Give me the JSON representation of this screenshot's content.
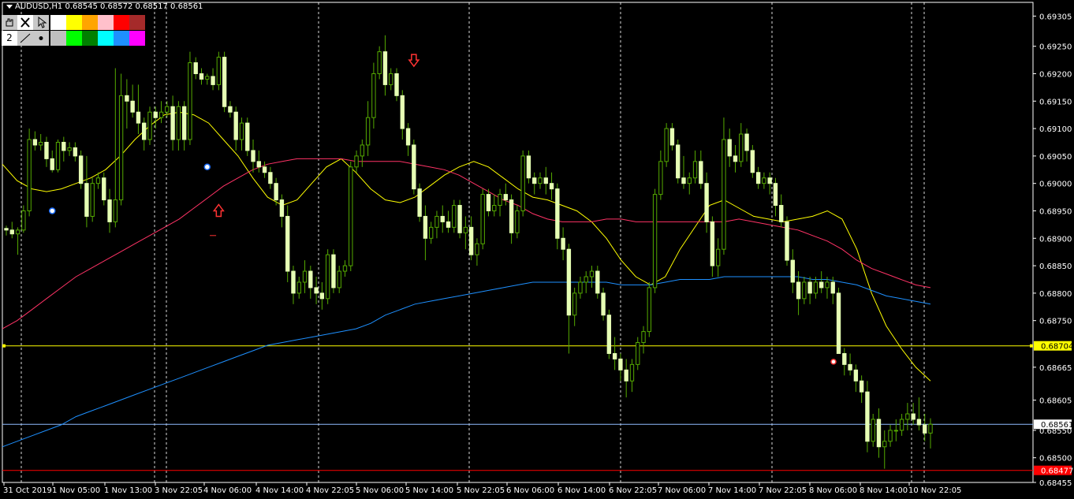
{
  "header": {
    "title": "AUDUSD,H1  0.68545 0.68572 0.68517 0.68561"
  },
  "toolbar": {
    "row1_icons": [
      "hand-icon",
      "close-icon",
      "pointer-icon"
    ],
    "row2": {
      "thickness_value": "2",
      "line_icon": "line-style-icon",
      "dot_icon": "dot-style-icon"
    },
    "colors_row1": [
      "#ffffff",
      "#ffff00",
      "#ffa500",
      "#ffc0cb",
      "#ff0000",
      "#a52a2a"
    ],
    "colors_row2": [
      "#c0c0c0",
      "#00ff00",
      "#008000",
      "#00ffff",
      "#1e90ff",
      "#ff00ff"
    ]
  },
  "colors": {
    "background": "#000000",
    "candle": "#e6ffb4",
    "wick": "#55aa00",
    "grid": "#ffffff",
    "ma_fast": "#ffff00",
    "ma_mid": "#ff3366",
    "ma_slow": "#1e90ff",
    "level_yellow": "#ffff00",
    "level_blue": "#8fbcff",
    "level_red": "#ff0000"
  },
  "chart_data": {
    "type": "candlestick",
    "symbol": "AUDUSD",
    "timeframe": "H1",
    "ylim": [
      0.68455,
      0.6933
    ],
    "y_ticks": [
      "0.69305",
      "0.69250",
      "0.69200",
      "0.69150",
      "0.69100",
      "0.69050",
      "0.69000",
      "0.68950",
      "0.68900",
      "0.68850",
      "0.68800",
      "0.68750",
      "0.68665",
      "0.68605",
      "0.68550",
      "0.68500",
      "0.68455"
    ],
    "x_ticks": [
      "31 Oct 2019",
      "1 Nov 05:00",
      "1 Nov 13:00",
      "3 Nov 22:05",
      "4 Nov 06:00",
      "4 Nov 14:00",
      "4 Nov 22:05",
      "5 Nov 06:00",
      "5 Nov 14:00",
      "5 Nov 22:05",
      "6 Nov 06:00",
      "6 Nov 14:00",
      "6 Nov 22:05",
      "7 Nov 06:00",
      "7 Nov 14:00",
      "7 Nov 22:05",
      "8 Nov 06:00",
      "8 Nov 14:00",
      "10 Nov 22:05"
    ],
    "levels": [
      {
        "name": "yellow-level",
        "value": 0.68704,
        "label": "0.68704",
        "color": "#ffff00"
      },
      {
        "name": "current-price",
        "value": 0.68561,
        "label": "0.68561",
        "color": "#8fbcff"
      },
      {
        "name": "red-level",
        "value": 0.68477,
        "label": "0.68477",
        "color": "#ff0000"
      }
    ],
    "candles": [
      [
        0.68918,
        0.68923,
        0.68905,
        0.68915
      ],
      [
        0.68915,
        0.6893,
        0.689,
        0.68908
      ],
      [
        0.68908,
        0.6892,
        0.6887,
        0.68915
      ],
      [
        0.68915,
        0.6896,
        0.6891,
        0.6895
      ],
      [
        0.6895,
        0.691,
        0.6894,
        0.6908
      ],
      [
        0.6908,
        0.69095,
        0.6906,
        0.6907
      ],
      [
        0.6907,
        0.6909,
        0.6906,
        0.69075
      ],
      [
        0.69075,
        0.69085,
        0.6903,
        0.69045
      ],
      [
        0.69045,
        0.6906,
        0.6902,
        0.69025
      ],
      [
        0.69025,
        0.6908,
        0.6902,
        0.69075
      ],
      [
        0.69075,
        0.69085,
        0.6904,
        0.6906
      ],
      [
        0.6906,
        0.69075,
        0.6905,
        0.69065
      ],
      [
        0.69065,
        0.69075,
        0.6904,
        0.6905
      ],
      [
        0.6905,
        0.6906,
        0.6899,
        0.69
      ],
      [
        0.69,
        0.6905,
        0.6892,
        0.6894
      ],
      [
        0.6894,
        0.6901,
        0.6893,
        0.69
      ],
      [
        0.69,
        0.6902,
        0.6899,
        0.6901
      ],
      [
        0.6901,
        0.6902,
        0.6896,
        0.6897
      ],
      [
        0.6897,
        0.6899,
        0.6891,
        0.6893
      ],
      [
        0.6893,
        0.6921,
        0.6892,
        0.6897
      ],
      [
        0.6897,
        0.692,
        0.6896,
        0.6916
      ],
      [
        0.6916,
        0.6919,
        0.691,
        0.6915
      ],
      [
        0.6915,
        0.6918,
        0.6912,
        0.6913
      ],
      [
        0.6913,
        0.6918,
        0.6909,
        0.6911
      ],
      [
        0.6911,
        0.6912,
        0.6906,
        0.6908
      ],
      [
        0.6908,
        0.6914,
        0.6907,
        0.6913
      ],
      [
        0.6913,
        0.6914,
        0.691,
        0.6912
      ],
      [
        0.6912,
        0.6915,
        0.6911,
        0.6913
      ],
      [
        0.6913,
        0.6915,
        0.6912,
        0.6914
      ],
      [
        0.6914,
        0.6916,
        0.6906,
        0.6908
      ],
      [
        0.6908,
        0.6915,
        0.6906,
        0.6914
      ],
      [
        0.6914,
        0.6915,
        0.6906,
        0.6908
      ],
      [
        0.6908,
        0.6924,
        0.6907,
        0.6922
      ],
      [
        0.6922,
        0.6923,
        0.6919,
        0.692
      ],
      [
        0.692,
        0.6921,
        0.6918,
        0.6919
      ],
      [
        0.6919,
        0.692,
        0.6918,
        0.69195
      ],
      [
        0.69195,
        0.6921,
        0.6917,
        0.6918
      ],
      [
        0.6918,
        0.6924,
        0.6917,
        0.6923
      ],
      [
        0.6923,
        0.6924,
        0.6913,
        0.6914
      ],
      [
        0.6914,
        0.6915,
        0.6912,
        0.6913
      ],
      [
        0.6913,
        0.6914,
        0.6906,
        0.6908
      ],
      [
        0.6908,
        0.6912,
        0.6906,
        0.6911
      ],
      [
        0.6911,
        0.6912,
        0.6905,
        0.6906
      ],
      [
        0.6906,
        0.6908,
        0.6902,
        0.6904
      ],
      [
        0.6904,
        0.6906,
        0.6902,
        0.6903
      ],
      [
        0.6903,
        0.6904,
        0.6901,
        0.6902
      ],
      [
        0.6902,
        0.6903,
        0.6899,
        0.69
      ],
      [
        0.69,
        0.6901,
        0.6896,
        0.6897
      ],
      [
        0.6897,
        0.6898,
        0.6892,
        0.6894
      ],
      [
        0.6894,
        0.6896,
        0.6882,
        0.6884
      ],
      [
        0.6884,
        0.6885,
        0.6878,
        0.688
      ],
      [
        0.688,
        0.6883,
        0.6879,
        0.6882
      ],
      [
        0.6882,
        0.6886,
        0.688,
        0.6884
      ],
      [
        0.6884,
        0.6885,
        0.6879,
        0.6881
      ],
      [
        0.6881,
        0.6883,
        0.6878,
        0.688
      ],
      [
        0.688,
        0.6882,
        0.6877,
        0.6879
      ],
      [
        0.6879,
        0.6888,
        0.6878,
        0.6887
      ],
      [
        0.6887,
        0.6888,
        0.688,
        0.6881
      ],
      [
        0.6881,
        0.6885,
        0.688,
        0.6884
      ],
      [
        0.6884,
        0.6886,
        0.6883,
        0.6885
      ],
      [
        0.6885,
        0.6904,
        0.6884,
        0.6903
      ],
      [
        0.6903,
        0.6906,
        0.6902,
        0.6905
      ],
      [
        0.6905,
        0.6908,
        0.6903,
        0.6907
      ],
      [
        0.6907,
        0.6915,
        0.6905,
        0.6912
      ],
      [
        0.6912,
        0.6922,
        0.691,
        0.692
      ],
      [
        0.692,
        0.6925,
        0.6919,
        0.6924
      ],
      [
        0.6924,
        0.6927,
        0.6916,
        0.6918
      ],
      [
        0.6918,
        0.6921,
        0.6917,
        0.692
      ],
      [
        0.692,
        0.6921,
        0.6915,
        0.6916
      ],
      [
        0.6916,
        0.6917,
        0.6908,
        0.691
      ],
      [
        0.691,
        0.6911,
        0.6905,
        0.6907
      ],
      [
        0.6907,
        0.6908,
        0.6898,
        0.6899
      ],
      [
        0.6899,
        0.69,
        0.6893,
        0.6894
      ],
      [
        0.6894,
        0.6896,
        0.6886,
        0.689
      ],
      [
        0.689,
        0.6893,
        0.6889,
        0.6892
      ],
      [
        0.6892,
        0.6895,
        0.689,
        0.6894
      ],
      [
        0.6894,
        0.6896,
        0.6891,
        0.6893
      ],
      [
        0.6893,
        0.6895,
        0.6891,
        0.6892
      ],
      [
        0.6892,
        0.6897,
        0.6891,
        0.6896
      ],
      [
        0.6896,
        0.6897,
        0.689,
        0.6891
      ],
      [
        0.6891,
        0.6894,
        0.6888,
        0.6892
      ],
      [
        0.6892,
        0.6894,
        0.6886,
        0.6887
      ],
      [
        0.6887,
        0.689,
        0.6885,
        0.6889
      ],
      [
        0.6889,
        0.6899,
        0.6888,
        0.6898
      ],
      [
        0.6898,
        0.6899,
        0.6894,
        0.6895
      ],
      [
        0.6895,
        0.6898,
        0.6894,
        0.6896
      ],
      [
        0.6896,
        0.6899,
        0.6894,
        0.6898
      ],
      [
        0.6898,
        0.69,
        0.6896,
        0.6897
      ],
      [
        0.6897,
        0.6898,
        0.6889,
        0.6891
      ],
      [
        0.6891,
        0.6896,
        0.689,
        0.6895
      ],
      [
        0.6895,
        0.6906,
        0.6894,
        0.6905
      ],
      [
        0.6905,
        0.6906,
        0.69,
        0.6901
      ],
      [
        0.6901,
        0.6902,
        0.6898,
        0.69
      ],
      [
        0.69,
        0.6902,
        0.6899,
        0.6901
      ],
      [
        0.6901,
        0.6903,
        0.6898,
        0.69
      ],
      [
        0.69,
        0.6902,
        0.6897,
        0.6899
      ],
      [
        0.6899,
        0.69,
        0.6888,
        0.689
      ],
      [
        0.689,
        0.6892,
        0.6886,
        0.6888
      ],
      [
        0.6888,
        0.6889,
        0.6869,
        0.6876
      ],
      [
        0.6876,
        0.6881,
        0.6874,
        0.688
      ],
      [
        0.688,
        0.6883,
        0.6879,
        0.6882
      ],
      [
        0.6882,
        0.6884,
        0.688,
        0.6883
      ],
      [
        0.6883,
        0.6885,
        0.6881,
        0.6884
      ],
      [
        0.6884,
        0.6885,
        0.6879,
        0.688
      ],
      [
        0.688,
        0.6881,
        0.6875,
        0.6876
      ],
      [
        0.6876,
        0.6877,
        0.6868,
        0.6869
      ],
      [
        0.6869,
        0.6872,
        0.6866,
        0.6868
      ],
      [
        0.6868,
        0.6869,
        0.6864,
        0.6866
      ],
      [
        0.6866,
        0.6868,
        0.6861,
        0.6864
      ],
      [
        0.6864,
        0.6868,
        0.6862,
        0.6867
      ],
      [
        0.6867,
        0.6872,
        0.6866,
        0.6871
      ],
      [
        0.6871,
        0.6874,
        0.6869,
        0.6873
      ],
      [
        0.6873,
        0.6882,
        0.6872,
        0.6881
      ],
      [
        0.6881,
        0.6899,
        0.688,
        0.6898
      ],
      [
        0.6898,
        0.6906,
        0.6897,
        0.6904
      ],
      [
        0.6904,
        0.6911,
        0.6903,
        0.691
      ],
      [
        0.691,
        0.6911,
        0.6906,
        0.6907
      ],
      [
        0.6907,
        0.6908,
        0.69,
        0.6901
      ],
      [
        0.6901,
        0.6905,
        0.6899,
        0.69
      ],
      [
        0.69,
        0.6902,
        0.6898,
        0.6901
      ],
      [
        0.6901,
        0.6906,
        0.69,
        0.6904
      ],
      [
        0.6904,
        0.6906,
        0.6899,
        0.69
      ],
      [
        0.69,
        0.6902,
        0.6891,
        0.6893
      ],
      [
        0.6893,
        0.6894,
        0.6883,
        0.6885
      ],
      [
        0.6885,
        0.689,
        0.6883,
        0.6888
      ],
      [
        0.6888,
        0.6912,
        0.6887,
        0.6908
      ],
      [
        0.6908,
        0.691,
        0.6903,
        0.6905
      ],
      [
        0.6905,
        0.6907,
        0.6902,
        0.6904
      ],
      [
        0.6904,
        0.6911,
        0.6903,
        0.6909
      ],
      [
        0.6909,
        0.691,
        0.6904,
        0.6906
      ],
      [
        0.6906,
        0.6907,
        0.6901,
        0.6902
      ],
      [
        0.6902,
        0.6903,
        0.6899,
        0.69
      ],
      [
        0.69,
        0.6902,
        0.6899,
        0.6901
      ],
      [
        0.6901,
        0.6902,
        0.6898,
        0.69
      ],
      [
        0.69,
        0.6901,
        0.6894,
        0.6896
      ],
      [
        0.6896,
        0.6898,
        0.6892,
        0.6893
      ],
      [
        0.6893,
        0.6894,
        0.6885,
        0.6886
      ],
      [
        0.6886,
        0.6888,
        0.688,
        0.6882
      ],
      [
        0.6882,
        0.6884,
        0.6876,
        0.6879
      ],
      [
        0.6879,
        0.6883,
        0.6878,
        0.6882
      ],
      [
        0.6882,
        0.6883,
        0.6878,
        0.688
      ],
      [
        0.688,
        0.6883,
        0.6879,
        0.6882
      ],
      [
        0.6882,
        0.6884,
        0.688,
        0.6881
      ],
      [
        0.6881,
        0.6883,
        0.6879,
        0.6882
      ],
      [
        0.6882,
        0.6883,
        0.6878,
        0.688
      ],
      [
        0.688,
        0.6881,
        0.6872,
        0.6869
      ],
      [
        0.6869,
        0.687,
        0.6865,
        0.6867
      ],
      [
        0.6867,
        0.6869,
        0.6865,
        0.6866
      ],
      [
        0.6866,
        0.6867,
        0.6862,
        0.6864
      ],
      [
        0.6864,
        0.6865,
        0.686,
        0.6862
      ],
      [
        0.6862,
        0.6864,
        0.6851,
        0.6853
      ],
      [
        0.6853,
        0.6858,
        0.6852,
        0.6857
      ],
      [
        0.6857,
        0.6859,
        0.685,
        0.6852
      ],
      [
        0.6852,
        0.6855,
        0.6848,
        0.6853
      ],
      [
        0.6853,
        0.6856,
        0.6852,
        0.6855
      ],
      [
        0.6855,
        0.6857,
        0.6853,
        0.6855
      ],
      [
        0.6855,
        0.6858,
        0.6854,
        0.6857
      ],
      [
        0.6857,
        0.686,
        0.6855,
        0.6858
      ],
      [
        0.6858,
        0.686,
        0.6856,
        0.6857
      ],
      [
        0.6857,
        0.6861,
        0.6855,
        0.6856
      ],
      [
        0.6856,
        0.6858,
        0.6853,
        0.68545
      ],
      [
        0.68545,
        0.68572,
        0.68517,
        0.68561
      ]
    ],
    "series": [
      {
        "name": "ma-fast",
        "color": "#ffff00",
        "values": [
          0.69035,
          0.69005,
          0.6899,
          0.68985,
          0.6899,
          0.69,
          0.6901,
          0.69025,
          0.6905,
          0.6908,
          0.69105,
          0.69125,
          0.6913,
          0.69125,
          0.6911,
          0.6908,
          0.6905,
          0.6901,
          0.68975,
          0.6896,
          0.6897,
          0.69,
          0.6903,
          0.69045,
          0.6902,
          0.6899,
          0.6897,
          0.68965,
          0.68975,
          0.68995,
          0.69015,
          0.6903,
          0.6904,
          0.6903,
          0.6901,
          0.6899,
          0.68975,
          0.6897,
          0.6896,
          0.6895,
          0.6893,
          0.689,
          0.6886,
          0.6883,
          0.68815,
          0.6883,
          0.6888,
          0.6892,
          0.6896,
          0.6897,
          0.68955,
          0.6894,
          0.68935,
          0.6893,
          0.68935,
          0.6894,
          0.6895,
          0.68935,
          0.6888,
          0.688,
          0.6874,
          0.687,
          0.68665,
          0.6864
        ]
      },
      {
        "name": "ma-mid",
        "color": "#ff3366",
        "values": [
          0.68735,
          0.6875,
          0.6877,
          0.6879,
          0.6881,
          0.6883,
          0.68845,
          0.6886,
          0.68875,
          0.6889,
          0.68905,
          0.6892,
          0.68935,
          0.68955,
          0.68975,
          0.68995,
          0.6901,
          0.69025,
          0.69035,
          0.6904,
          0.69045,
          0.69045,
          0.69045,
          0.69045,
          0.6904,
          0.6904,
          0.6904,
          0.6904,
          0.69035,
          0.6903,
          0.69025,
          0.69015,
          0.69,
          0.68985,
          0.6897,
          0.6896,
          0.68945,
          0.68935,
          0.6893,
          0.6893,
          0.6893,
          0.68935,
          0.68935,
          0.6893,
          0.6893,
          0.6893,
          0.6893,
          0.6893,
          0.6893,
          0.6893,
          0.68935,
          0.6893,
          0.68925,
          0.6892,
          0.68915,
          0.68905,
          0.68895,
          0.6888,
          0.6886,
          0.68845,
          0.68835,
          0.68825,
          0.68815,
          0.6881
        ]
      },
      {
        "name": "ma-slow",
        "color": "#1e90ff",
        "values": [
          0.6852,
          0.6853,
          0.6854,
          0.6855,
          0.6856,
          0.68575,
          0.68585,
          0.68595,
          0.68605,
          0.68615,
          0.68625,
          0.68635,
          0.68645,
          0.68655,
          0.68665,
          0.68675,
          0.68685,
          0.68695,
          0.68705,
          0.6871,
          0.68715,
          0.6872,
          0.68725,
          0.6873,
          0.68735,
          0.68745,
          0.6876,
          0.6877,
          0.6878,
          0.68785,
          0.6879,
          0.68795,
          0.688,
          0.68805,
          0.6881,
          0.68815,
          0.6882,
          0.6882,
          0.6882,
          0.6882,
          0.6882,
          0.6882,
          0.68815,
          0.68815,
          0.68815,
          0.6882,
          0.68825,
          0.68825,
          0.68825,
          0.6883,
          0.6883,
          0.6883,
          0.6883,
          0.6883,
          0.6883,
          0.68825,
          0.68825,
          0.6882,
          0.68815,
          0.68805,
          0.68795,
          0.6879,
          0.68785,
          0.6878
        ]
      }
    ],
    "signals": [
      {
        "type": "up-arrow",
        "index": 37,
        "price": 0.6895
      },
      {
        "type": "down-arrow",
        "index": 71,
        "price": 0.69225
      },
      {
        "type": "blue-dot",
        "index": 8,
        "price": 0.6895
      },
      {
        "type": "blue-dot",
        "index": 35,
        "price": 0.6903
      },
      {
        "type": "red-dash",
        "index": 36,
        "price": 0.68905
      },
      {
        "type": "red-dot",
        "index": 304,
        "price": 0.68675
      }
    ]
  }
}
